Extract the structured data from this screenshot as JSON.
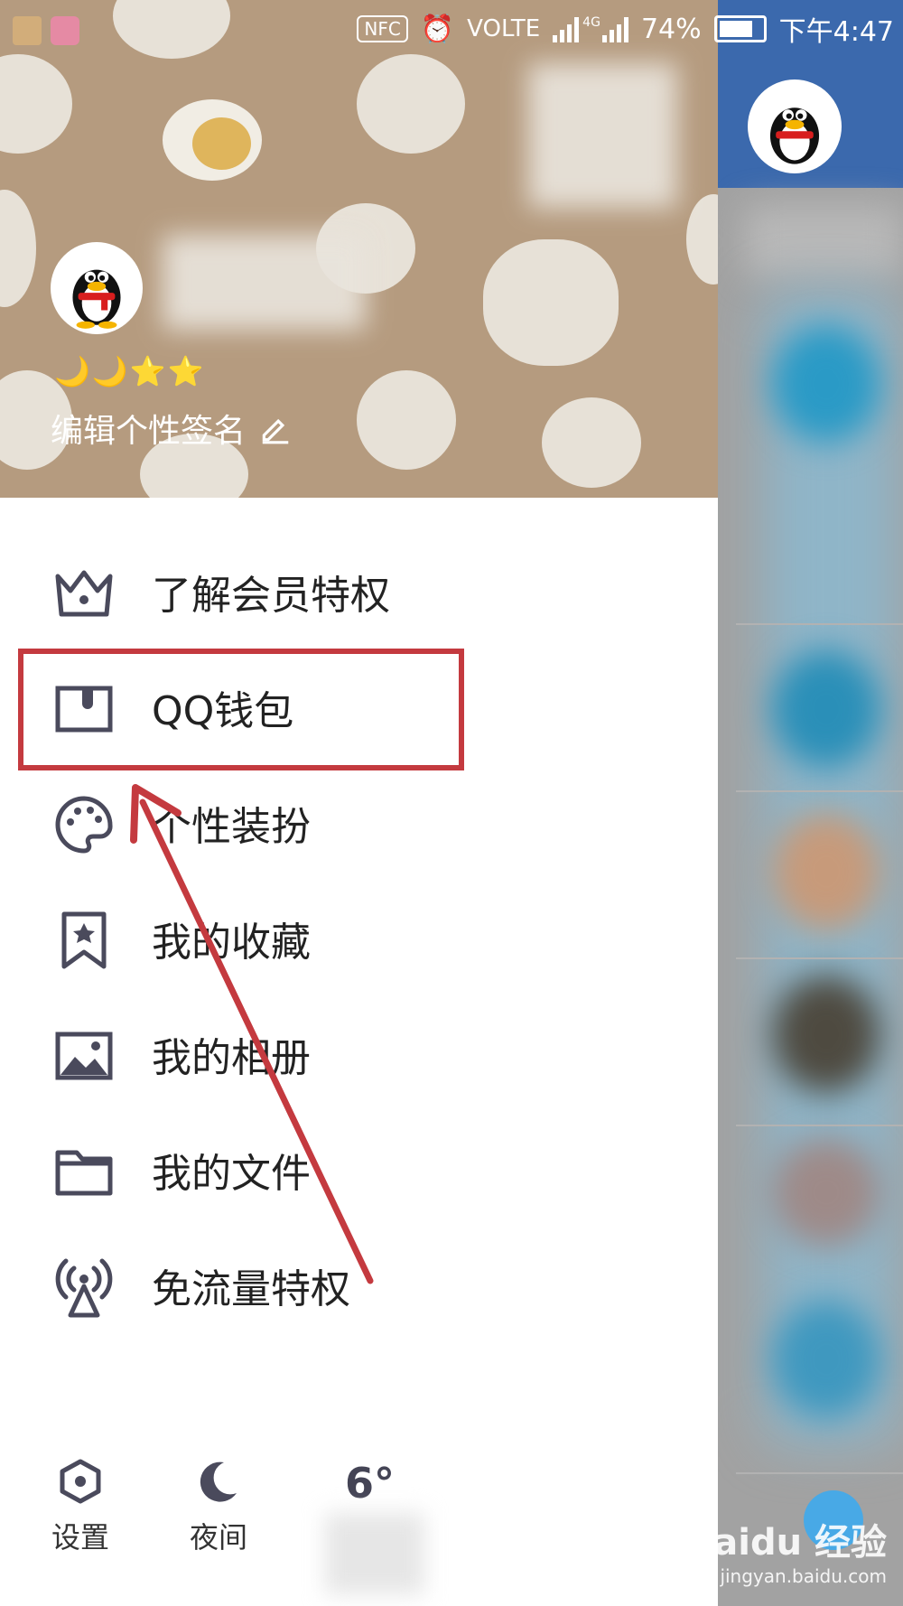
{
  "status_bar": {
    "nfc": "NFC",
    "network": "VOLTE",
    "signal_tag": "4G",
    "battery_percent": "74%",
    "time": "下午4:47"
  },
  "profile": {
    "level_icons": "🌙🌙⭐⭐",
    "signature": "编辑个性签名"
  },
  "menu": {
    "items": [
      {
        "label": "了解会员特权",
        "icon": "crown-icon"
      },
      {
        "label": "QQ钱包",
        "icon": "wallet-icon"
      },
      {
        "label": "个性装扮",
        "icon": "palette-icon"
      },
      {
        "label": "我的收藏",
        "icon": "bookmark-star-icon"
      },
      {
        "label": "我的相册",
        "icon": "image-icon"
      },
      {
        "label": "我的文件",
        "icon": "folder-icon"
      },
      {
        "label": "免流量特权",
        "icon": "broadcast-icon"
      }
    ]
  },
  "bottom_bar": {
    "settings": "设置",
    "night": "夜间",
    "weather_temp": "6°"
  },
  "watermark": {
    "brand": "Baidu 经验",
    "url": "jingyan.baidu.com"
  },
  "colors": {
    "header_bg": "#b59b7f",
    "highlight": "#c43a3f",
    "right_header": "#3b69ad",
    "icon": "#4a4a5c"
  }
}
